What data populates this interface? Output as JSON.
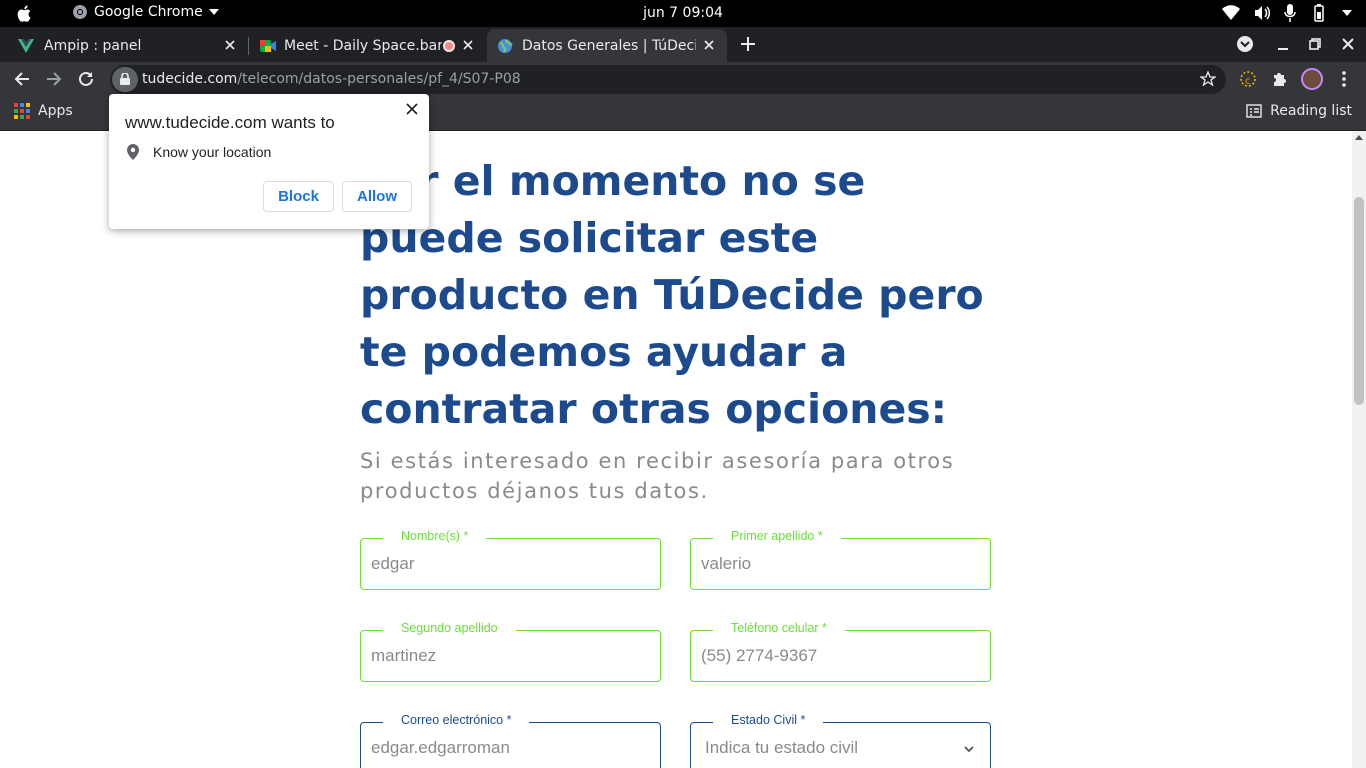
{
  "os_bar": {
    "app_name": "Google Chrome",
    "clock": "jun 7  09:04"
  },
  "tabs": [
    {
      "title": "Ampip : panel",
      "favicon": "vue-icon"
    },
    {
      "title": "Meet - Daily Space.bar",
      "favicon": "meet-icon",
      "recording": true
    },
    {
      "title": "Datos Generales | TúDecide",
      "favicon": "globe-icon",
      "active": true
    }
  ],
  "address_bar": {
    "domain": "tudecide.com",
    "path": "/telecom/datos-personales/pf_4/S07-P08"
  },
  "bookmarks": {
    "apps_label": "Apps",
    "reading_list_label": "Reading list"
  },
  "permission_popup": {
    "title": "www.tudecide.com wants to",
    "permission": "Know your location",
    "block_label": "Block",
    "allow_label": "Allow"
  },
  "main": {
    "headline_lines": [
      "Por el momento no se",
      "puede solicitar este",
      "producto en TúDecide pero",
      "te podemos ayudar a",
      "contratar otras opciones:"
    ],
    "subtitle_lines": [
      "Si estás interesado en recibir asesoría para otros",
      "productos déjanos tus datos."
    ]
  },
  "form": {
    "nombre": {
      "label": "Nombre(s) *",
      "value": "edgar"
    },
    "primer_apellido": {
      "label": "Primer apellido *",
      "value": "valerio"
    },
    "segundo_apellido": {
      "label": "Segundo apellido",
      "value": "martinez"
    },
    "telefono": {
      "label": "Teléfono celular *",
      "value": "(55) 2774-9367"
    },
    "correo": {
      "label": "Correo electrónico *",
      "value": "edgar.edgarroman"
    },
    "estado_civil": {
      "label": "Estado Civil *",
      "placeholder": "Indica tu estado civil"
    }
  },
  "colors": {
    "heading_blue": "#1d4a8c",
    "valid_green": "#6adf3a",
    "chrome_dark": "#202124",
    "chrome_toolbar": "#35363a",
    "link_blue": "#1a73e8"
  }
}
